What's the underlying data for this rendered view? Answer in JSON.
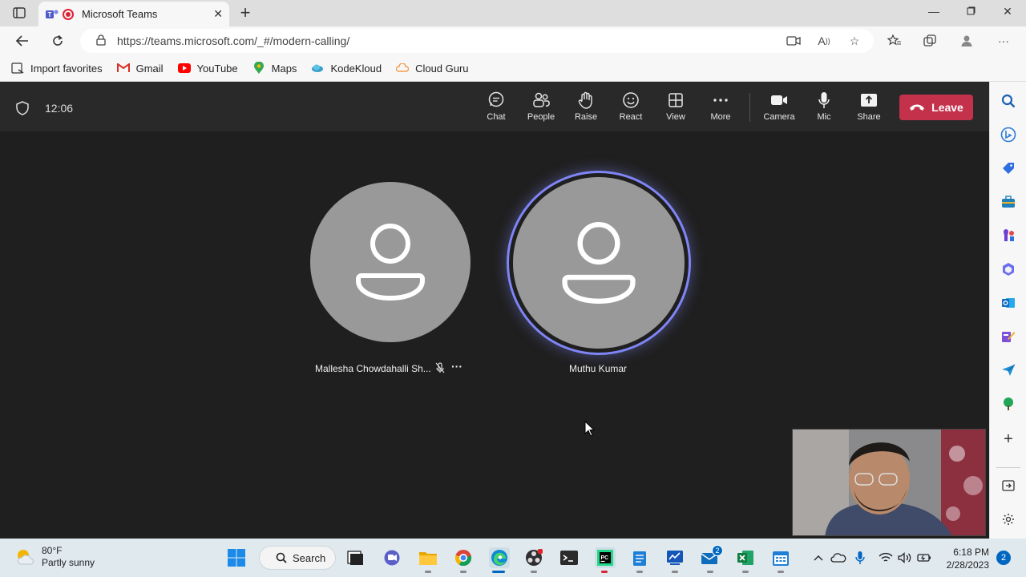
{
  "browser": {
    "tab_title": "Microsoft Teams",
    "url": "https://teams.microsoft.com/_#/modern-calling/",
    "favorites": [
      {
        "label": "Import favorites",
        "icon": "import-icon"
      },
      {
        "label": "Gmail",
        "icon": "gmail-icon",
        "color": "#d93025"
      },
      {
        "label": "YouTube",
        "icon": "youtube-icon",
        "color": "#ff0000"
      },
      {
        "label": "Maps",
        "icon": "maps-icon",
        "color": "#34a853"
      },
      {
        "label": "KodeKloud",
        "icon": "kodekloud-icon",
        "color": "#3aa0c9"
      },
      {
        "label": "Cloud Guru",
        "icon": "cloud-guru-icon",
        "color": "#f39c4a"
      }
    ]
  },
  "meeting": {
    "timer": "12:06",
    "toolbar": {
      "chat": "Chat",
      "people": "People",
      "raise": "Raise",
      "react": "React",
      "view": "View",
      "more": "More",
      "camera": "Camera",
      "mic": "Mic",
      "share": "Share",
      "leave": "Leave"
    },
    "participants": [
      {
        "name": "Mallesha Chowdahalli Sh...",
        "muted": true,
        "speaking": false
      },
      {
        "name": "Muthu Kumar",
        "muted": false,
        "speaking": true
      }
    ],
    "colors": {
      "leave": "#c4314b",
      "speaking_ring": "#7f85f5"
    }
  },
  "taskbar": {
    "weather_temp": "80°F",
    "weather_desc": "Partly sunny",
    "search_label": "Search",
    "time": "6:18 PM",
    "date": "2/28/2023",
    "notification_count": "2",
    "mail_badge": "2"
  }
}
